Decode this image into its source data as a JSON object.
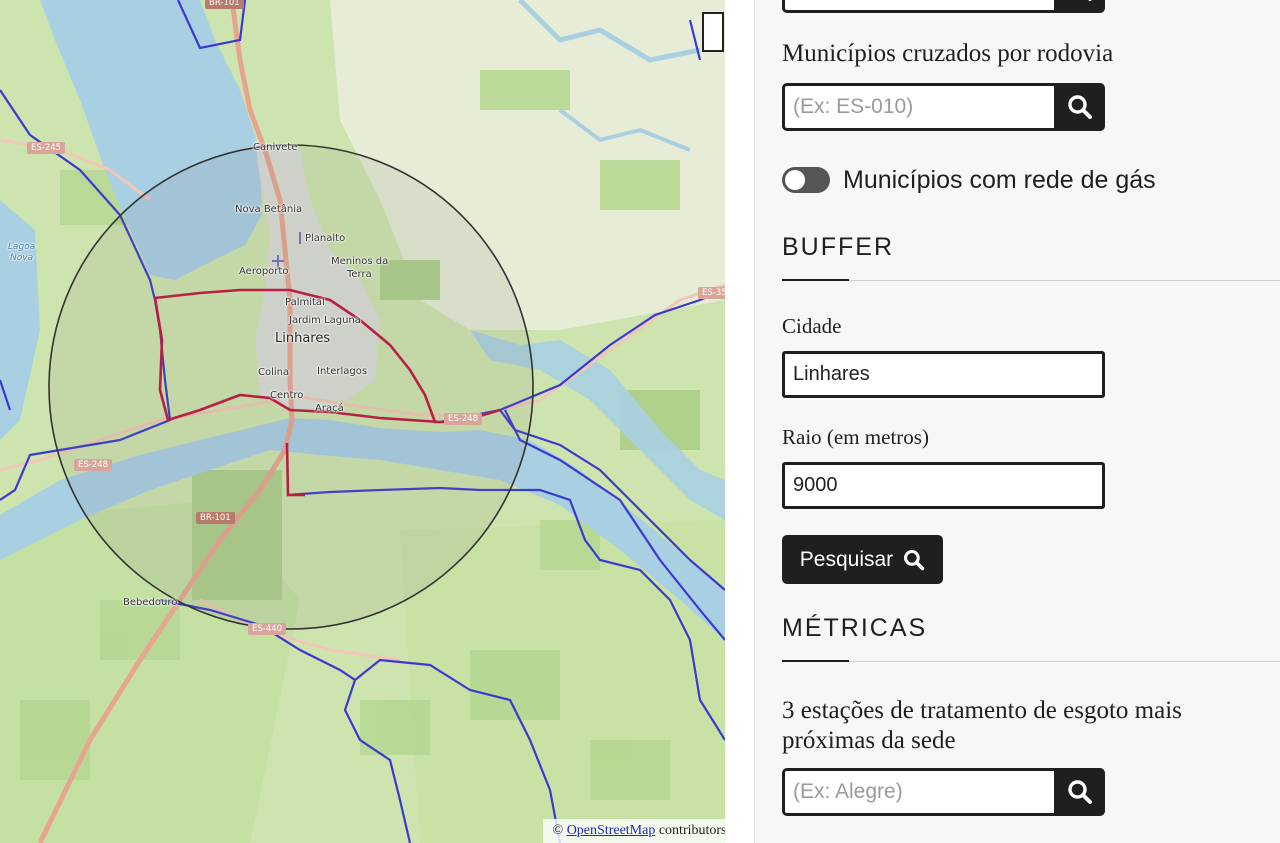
{
  "map": {
    "attribution_prefix": "©",
    "attribution_link": "OpenStreetMap",
    "attribution_suffix": "contributors.",
    "labels": {
      "canivete": "Canivete",
      "nova_betania": "Nova Betânia",
      "planalto": "Planalto",
      "meninos_da_terra_1": "Meninos da",
      "meninos_da_terra_2": "Terra",
      "aeroporto": "Aeroporto",
      "palmital": "Palmital",
      "jardim_laguna": "Jardim Laguna",
      "linhares": "Linhares",
      "colina": "Colina",
      "interlagos": "Interlagos",
      "centro": "Centro",
      "araca": "Araçá",
      "bebedouro": "Bebedouro",
      "lagoa_nova_1": "Lagoa",
      "lagoa_nova_2": "Nova"
    },
    "shields": {
      "br101_top": "BR-101",
      "br101_mid": "BR-101",
      "es245": "ES-245",
      "es248": "ES-248",
      "es248_left": "ES-248",
      "es440": "ES-440",
      "es358": "ES-35"
    }
  },
  "panel": {
    "rodovia_label": "Municípios cruzados por rodovia",
    "rodovia_placeholder": "(Ex: ES-010)",
    "gas_label": "Municípios com rede de gás",
    "buffer_title": "BUFFER",
    "cidade_label": "Cidade",
    "cidade_value": "Linhares",
    "raio_label": "Raio (em metros)",
    "raio_value": "9000",
    "pesquisar_label": "Pesquisar",
    "metricas_title": "MÉTRICAS",
    "ete_label": "3 estações de tratamento de esgoto mais próximas da sede",
    "ete_placeholder": "(Ex: Alegre)"
  },
  "colors": {
    "accent": "#1f1f1f",
    "boundary_highlight": "#c0143c",
    "boundary_lines": "#3a3acf",
    "river": "#a9cfe3"
  },
  "icons": [
    "search-icon",
    "toggle-switch"
  ]
}
